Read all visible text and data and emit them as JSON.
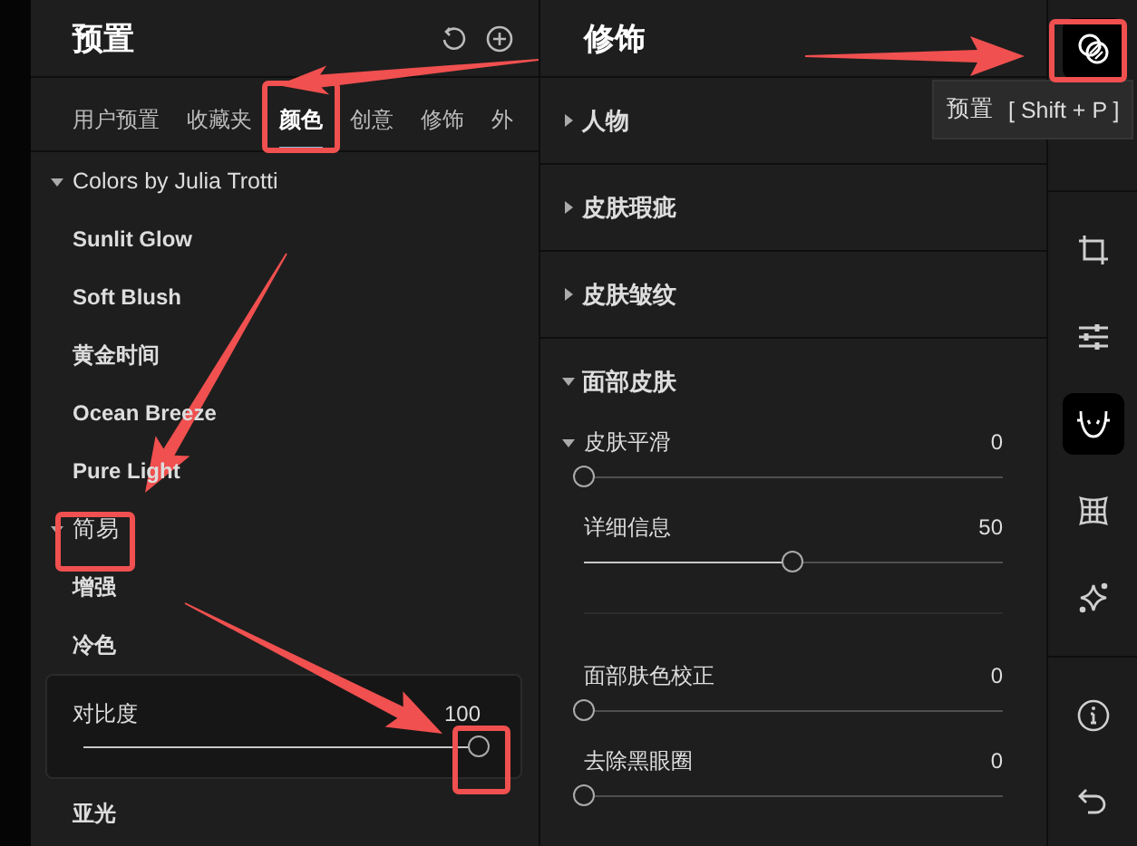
{
  "presets_panel": {
    "title": "预置",
    "tabs": [
      {
        "label": "用户预置",
        "selected": false
      },
      {
        "label": "收藏夹",
        "selected": false
      },
      {
        "label": "颜色",
        "selected": true
      },
      {
        "label": "创意",
        "selected": false
      },
      {
        "label": "修饰",
        "selected": false
      },
      {
        "label": "外",
        "selected": false
      }
    ],
    "groups": [
      {
        "name": "Colors by Julia Trotti",
        "expanded": true,
        "items": [
          {
            "kind": "preset",
            "label": "Sunlit Glow"
          },
          {
            "kind": "preset",
            "label": "Soft Blush"
          },
          {
            "kind": "preset",
            "label": "黄金时间"
          },
          {
            "kind": "preset",
            "label": "Ocean Breeze"
          },
          {
            "kind": "preset",
            "label": "Pure Light"
          }
        ]
      },
      {
        "name": "简易",
        "expanded": true,
        "items": [
          {
            "kind": "preset",
            "label": "增强"
          },
          {
            "kind": "preset",
            "label": "冷色"
          },
          {
            "kind": "amount",
            "label": "对比度",
            "reading": "100",
            "level": 1
          },
          {
            "kind": "preset",
            "label": "亚光"
          }
        ]
      }
    ]
  },
  "edit_panel": {
    "title": "修饰",
    "sections": [
      {
        "label": "人物",
        "expanded": false
      },
      {
        "label": "皮肤瑕疵",
        "expanded": false
      },
      {
        "label": "皮肤皱纹",
        "expanded": false
      },
      {
        "label": "面部皮肤",
        "expanded": true,
        "control_groups": [
          {
            "controls": [
              {
                "kind": "expandable",
                "label": "皮肤平滑",
                "reading": "0",
                "level": 0
              },
              {
                "kind": "slider",
                "label": "详细信息",
                "reading": "50",
                "level": 0.5
              }
            ]
          },
          {
            "controls": [
              {
                "kind": "slider",
                "label": "面部肤色校正",
                "reading": "0",
                "level": 0
              },
              {
                "kind": "slider",
                "label": "去除黑眼圈",
                "reading": "0",
                "level": 0
              }
            ]
          }
        ]
      }
    ]
  },
  "toolbar": {
    "groups": [
      {
        "tools": [
          {
            "kind": "presets",
            "selected": true
          }
        ]
      },
      {
        "tools": [
          {
            "kind": "crop",
            "selected": false
          },
          {
            "kind": "adjust",
            "selected": false
          },
          {
            "kind": "retouch",
            "selected": true
          },
          {
            "kind": "geometry",
            "selected": false
          },
          {
            "kind": "effects",
            "selected": false
          }
        ]
      },
      {
        "tools": [
          {
            "kind": "info",
            "selected": false
          },
          {
            "kind": "undo",
            "selected": false
          }
        ]
      }
    ],
    "tooltip": {
      "label": "预置",
      "shortcut": "[ Shift + P ]"
    }
  }
}
